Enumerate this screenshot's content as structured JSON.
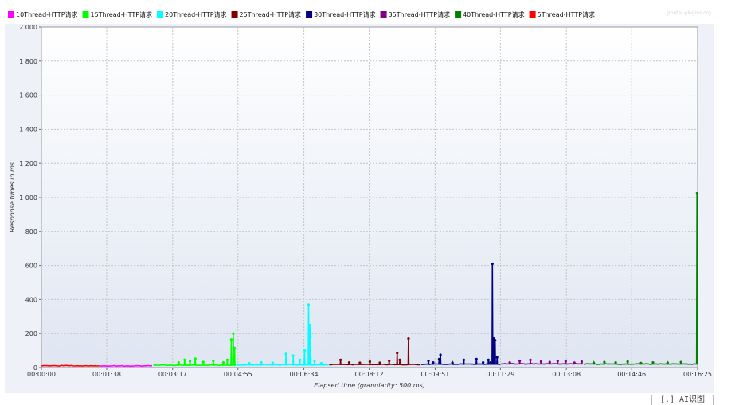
{
  "watermark": "jmeter-plugins.org",
  "chart_data": {
    "type": "line",
    "xlabel": "Elapsed time (granularity: 500 ms)",
    "ylabel": "Response times in ms",
    "x_unit": "seconds",
    "ylim": [
      0,
      2000
    ],
    "yticks": [
      0,
      200,
      400,
      600,
      800,
      1000,
      1200,
      1400,
      1600,
      1800,
      2000
    ],
    "ytick_labels": [
      "0",
      "200",
      "400",
      "600",
      "800",
      "1 000",
      "1 200",
      "1 400",
      "1 600",
      "1 800",
      "2 000"
    ],
    "xlim": [
      0,
      985
    ],
    "xticks": [
      0,
      98,
      197,
      295,
      394,
      492,
      591,
      689,
      788,
      886,
      985
    ],
    "xtick_labels": [
      "00:00:00",
      "00:01:38",
      "00:03:17",
      "00:04:55",
      "00:06:34",
      "00:08:12",
      "00:09:51",
      "00:11:29",
      "00:13:08",
      "00:14:46",
      "00:16:25"
    ],
    "grid": true,
    "legend_position": "top",
    "series": [
      {
        "name": "10Thread-HTTP请求",
        "color": "#ff00ff",
        "baseline": 10,
        "x_range": [
          88,
          168
        ],
        "spikes": []
      },
      {
        "name": "15Thread-HTTP请求",
        "color": "#00ff00",
        "baseline": 14,
        "x_range": [
          168,
          294
        ],
        "spikes": [
          [
            206,
            30
          ],
          [
            215,
            45
          ],
          [
            223,
            38
          ],
          [
            231,
            52
          ],
          [
            243,
            33
          ],
          [
            258,
            40
          ],
          [
            273,
            30
          ],
          [
            279,
            45
          ],
          [
            285,
            165
          ],
          [
            288,
            200
          ],
          [
            290,
            115
          ]
        ]
      },
      {
        "name": "20Thread-HTTP请求",
        "color": "#00ffff",
        "baseline": 16,
        "x_range": [
          294,
          432
        ],
        "spikes": [
          [
            312,
            25
          ],
          [
            330,
            30
          ],
          [
            347,
            28
          ],
          [
            367,
            80
          ],
          [
            378,
            70
          ],
          [
            388,
            45
          ],
          [
            395,
            100
          ],
          [
            401,
            370
          ],
          [
            403,
            250
          ],
          [
            404,
            180
          ],
          [
            410,
            40
          ],
          [
            420,
            25
          ]
        ]
      },
      {
        "name": "25Thread-HTTP请求",
        "color": "#800000",
        "baseline": 18,
        "x_range": [
          432,
          570
        ],
        "spikes": [
          [
            449,
            45
          ],
          [
            462,
            30
          ],
          [
            478,
            28
          ],
          [
            493,
            35
          ],
          [
            508,
            28
          ],
          [
            522,
            40
          ],
          [
            534,
            85
          ],
          [
            538,
            45
          ],
          [
            551,
            170
          ]
        ]
      },
      {
        "name": "30Thread-HTTP请求",
        "color": "#000080",
        "baseline": 20,
        "x_range": [
          570,
          690
        ],
        "spikes": [
          [
            581,
            40
          ],
          [
            588,
            30
          ],
          [
            597,
            50
          ],
          [
            599,
            75
          ],
          [
            617,
            28
          ],
          [
            634,
            45
          ],
          [
            653,
            50
          ],
          [
            663,
            30
          ],
          [
            671,
            45
          ],
          [
            674,
            30
          ],
          [
            677,
            610
          ],
          [
            679,
            170
          ],
          [
            681,
            160
          ],
          [
            684,
            60
          ]
        ]
      },
      {
        "name": "35Thread-HTTP请求",
        "color": "#800080",
        "baseline": 22,
        "x_range": [
          690,
          814
        ],
        "spikes": [
          [
            703,
            30
          ],
          [
            718,
            40
          ],
          [
            734,
            45
          ],
          [
            750,
            35
          ],
          [
            763,
            32
          ],
          [
            775,
            40
          ],
          [
            787,
            38
          ],
          [
            800,
            28
          ],
          [
            811,
            35
          ]
        ]
      },
      {
        "name": "40Thread-HTTP请求",
        "color": "#008000",
        "baseline": 21,
        "x_range": [
          814,
          985
        ],
        "spikes": [
          [
            829,
            28
          ],
          [
            845,
            32
          ],
          [
            862,
            30
          ],
          [
            880,
            35
          ],
          [
            900,
            26
          ],
          [
            918,
            30
          ],
          [
            940,
            28
          ],
          [
            960,
            32
          ],
          [
            984,
            1025
          ]
        ]
      },
      {
        "name": "5Thread-HTTP请求",
        "color": "#ff0000",
        "baseline": 11,
        "x_range": [
          0,
          88
        ],
        "spikes": []
      }
    ]
  },
  "widget": {
    "label": "[.] AI识图"
  }
}
